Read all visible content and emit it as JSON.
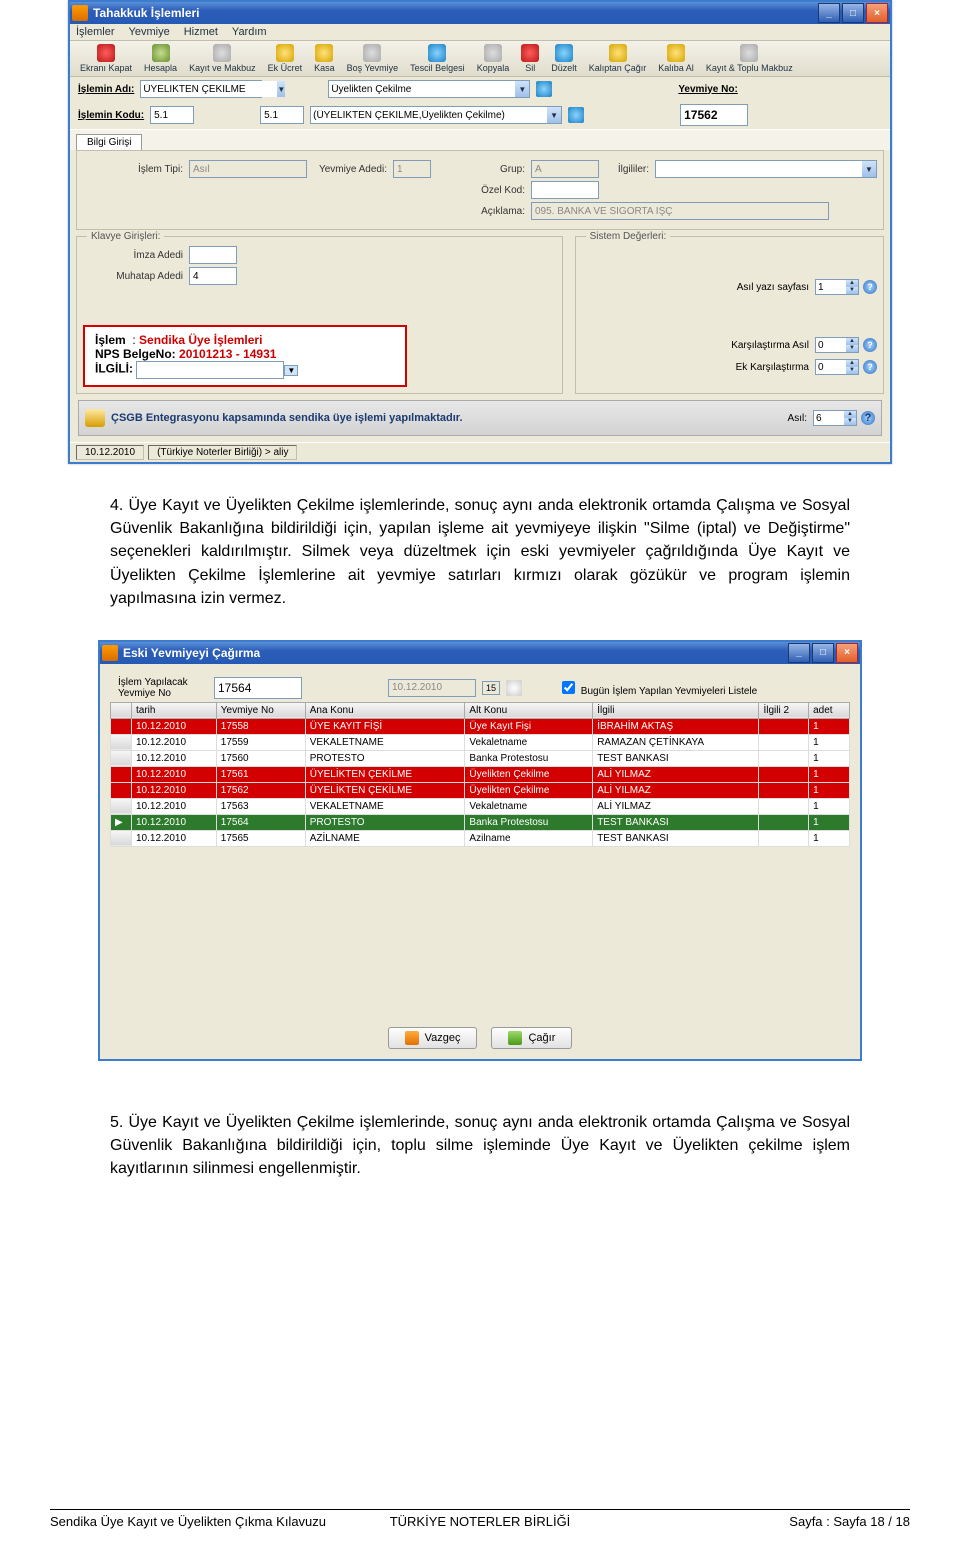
{
  "win1": {
    "title": "Tahakkuk İşlemleri",
    "menu": [
      "İşlemler",
      "Yevmiye",
      "Hizmet",
      "Yardım"
    ],
    "toolbar": [
      {
        "label": "Ekranı Kapat",
        "ic": "ic-close"
      },
      {
        "label": "Hesapla",
        "ic": "ic-calc"
      },
      {
        "label": "Kayıt ve Makbuz",
        "ic": "ic-gray"
      },
      {
        "label": "Ek Ücret",
        "ic": "ic-yel"
      },
      {
        "label": "Kasa",
        "ic": "ic-yel"
      },
      {
        "label": "Boş Yevmiye",
        "ic": "ic-gray"
      },
      {
        "label": "Tescil Belgesi",
        "ic": "ic-doc"
      },
      {
        "label": "Kopyala",
        "ic": "ic-gray"
      },
      {
        "label": "Sil",
        "ic": "ic-close"
      },
      {
        "label": "Düzelt",
        "ic": "ic-doc"
      },
      {
        "label": "Kalıptan Çağır",
        "ic": "ic-yel"
      },
      {
        "label": "Kalıba Al",
        "ic": "ic-yel"
      },
      {
        "label": "Kayıt & Toplu Makbuz",
        "ic": "ic-gray"
      }
    ],
    "islem_adi_label": "İşlemin Adı:",
    "islem_adi_value": "ÜYELİKTEN ÇEKİLME",
    "islem_adi_dd": "Üyelikten Çekilme",
    "islem_kodu_label": "İşlemin Kodu:",
    "islem_kodu_value": "5.1",
    "islem_kodu_value2": "5.1",
    "islem_kodu_dd": "(ÜYELİKTEN ÇEKİLME,Üyelikten Çekilme)",
    "yevmiye_no_label": "Yevmiye No:",
    "yevmiye_no_value": "17562",
    "bilgi_tab": "Bilgi Girişi",
    "grup_label": "Grup:",
    "grup_value": "A",
    "ozel_kod_label": "Özel Kod:",
    "islem_tipi_label": "İşlem Tipi:",
    "islem_tipi_value": "Asıl",
    "yevmiye_adedi_label": "Yevmiye Adedi:",
    "yevmiye_adedi_value": "1",
    "ilgililer_label": "İlgililer:",
    "aciklama_label": "Açıklama:",
    "aciklama_value": "095. BANKA VE SİGORTA İŞÇ",
    "klavye_title": "Klavye Girişleri:",
    "imza_label": "İmza Adedi",
    "muhatap_label": "Muhatap Adedi",
    "muhatap_value": "4",
    "redbox_islem": "İşlem",
    "redbox_islem_v": "Sendika Üye İşlemleri",
    "redbox_nps": "NPS BelgeNo:",
    "redbox_nps_v": "20101213 - 14931",
    "redbox_ilgili": "İLGİLİ:",
    "banner": "ÇSGB Entegrasyonu kapsamında sendika üye işlemi yapılmaktadır.",
    "sistem_title": "Sistem Değerleri:",
    "asil_yazi_label": "Asıl yazı sayfası",
    "asil_yazi_v": "1",
    "kars_asil_label": "Karşılaştırma Asıl",
    "kars_asil_v": "0",
    "ek_kars_label": "Ek Karşılaştırma",
    "ek_kars_v": "0",
    "asil_label": "Asıl:",
    "asil_v": "6",
    "status_date": "10.12.2010",
    "status_src": "(Türkiye Noterler Birliği) > aliy"
  },
  "para1": "4. Üye Kayıt ve Üyelikten Çekilme işlemlerinde, sonuç aynı anda elektronik ortamda Çalışma ve Sosyal Güvenlik Bakanlığına bildirildiği için, yapılan işleme ait yevmiyeye ilişkin \"Silme (iptal) ve Değiştirme\" seçenekleri kaldırılmıştır. Silmek veya düzeltmek için eski yevmiyeler çağrıldığında Üye Kayıt ve Üyelikten Çekilme İşlemlerine ait yevmiye satırları kırmızı olarak gözükür ve program işlemin yapılmasına izin vermez.",
  "win2": {
    "title": "Eski Yevmiyeyi Çağırma",
    "lbl1": "İşlem Yapılacak Yevmiye No",
    "yev_no": "17564",
    "date": "10.12.2010",
    "day": "15",
    "chk": "Bugün İşlem Yapılan Yevmiyeleri Listele",
    "headers": [
      "tarih",
      "Yevmiye No",
      "Ana Konu",
      "Alt Konu",
      "İlgili",
      "İlgili 2",
      "adet"
    ],
    "rows": [
      {
        "cls": "red",
        "c": [
          "10.12.2010",
          "17558",
          "ÜYE KAYIT FİŞİ",
          "Üye Kayıt Fişi",
          "İBRAHİM AKTAŞ",
          "",
          "1"
        ]
      },
      {
        "cls": "",
        "c": [
          "10.12.2010",
          "17559",
          "VEKALETNAME",
          "Vekaletname",
          "RAMAZAN ÇETİNKAYA",
          "",
          "1"
        ]
      },
      {
        "cls": "",
        "c": [
          "10.12.2010",
          "17560",
          "PROTESTO",
          "Banka Protestosu",
          "TEST BANKASI",
          "",
          "1"
        ]
      },
      {
        "cls": "red",
        "c": [
          "10.12.2010",
          "17561",
          "ÜYELİKTEN ÇEKİLME",
          "Üyelikten Çekilme",
          "ALİ YILMAZ",
          "",
          "1"
        ]
      },
      {
        "cls": "red",
        "c": [
          "10.12.2010",
          "17562",
          "ÜYELİKTEN ÇEKİLME",
          "Üyelikten Çekilme",
          "ALİ YILMAZ",
          "",
          "1"
        ]
      },
      {
        "cls": "",
        "c": [
          "10.12.2010",
          "17563",
          "VEKALETNAME",
          "Vekaletname",
          "ALİ YILMAZ",
          "",
          "1"
        ]
      },
      {
        "cls": "sel",
        "c": [
          "10.12.2010",
          "17564",
          "PROTESTO",
          "Banka Protestosu",
          "TEST BANKASI",
          "",
          "1"
        ]
      },
      {
        "cls": "",
        "c": [
          "10.12.2010",
          "17565",
          "AZİLNAME",
          "Azilname",
          "TEST BANKASI",
          "",
          "1"
        ]
      }
    ],
    "btn_vazgec": "Vazgeç",
    "btn_cagir": "Çağır"
  },
  "para2": "5. Üye Kayıt ve Üyelikten Çekilme işlemlerinde, sonuç aynı anda elektronik ortamda Çalışma ve Sosyal Güvenlik Bakanlığına bildirildiği için, toplu silme işleminde Üye Kayıt ve Üyelikten çekilme işlem kayıtlarının silinmesi engellenmiştir.",
  "footer": {
    "center": "TÜRKİYE NOTERLER BİRLİĞİ",
    "left": "Sendika Üye Kayıt ve Üyelikten Çıkma Kılavuzu",
    "right": "Sayfa : Sayfa 18 / 18"
  }
}
